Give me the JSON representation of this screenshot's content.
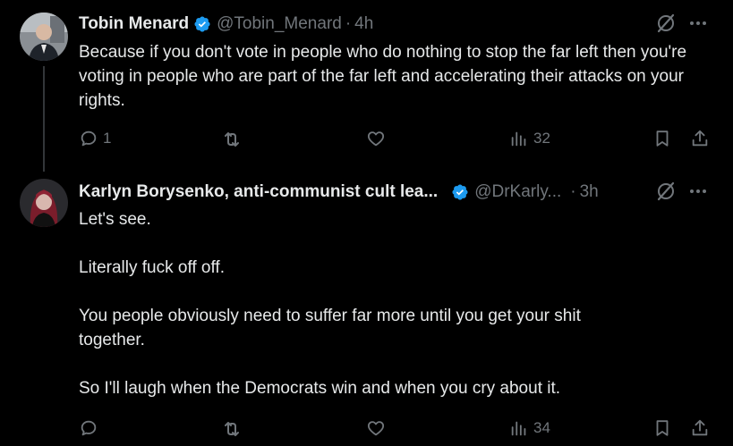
{
  "posts": [
    {
      "author_name": "Tobin Menard",
      "handle": "@Tobin_Menard",
      "separator": "·",
      "time": "4h",
      "paragraphs": [
        "Because if you don't vote in people who do nothing to stop the far left then you're voting in people who are part of the far left and accelerating their attacks on your rights."
      ],
      "reply_count": "1",
      "repost_count": "",
      "like_count": "",
      "views_count": "32"
    },
    {
      "author_name": "Karlyn Borysenko, anti-communist cult lea...",
      "handle": "@DrKarly...",
      "separator": "·",
      "time": "3h",
      "paragraphs": [
        "Let's see.",
        "Literally fuck off off.",
        "You people obviously need to suffer far more until you get your shit together.",
        "So I'll laugh when the Democrats win and when you cry about it."
      ],
      "reply_count": "",
      "repost_count": "",
      "like_count": "",
      "views_count": "34"
    }
  ],
  "colors": {
    "background": "#000000",
    "text": "#e7e9ea",
    "muted": "#71767b",
    "verified": "#1d9bf0",
    "thread_line": "#333639"
  },
  "icons": [
    "verified-badge-icon",
    "grok-icon",
    "more-icon",
    "reply-icon",
    "repost-icon",
    "like-icon",
    "views-icon",
    "bookmark-icon",
    "share-icon"
  ]
}
